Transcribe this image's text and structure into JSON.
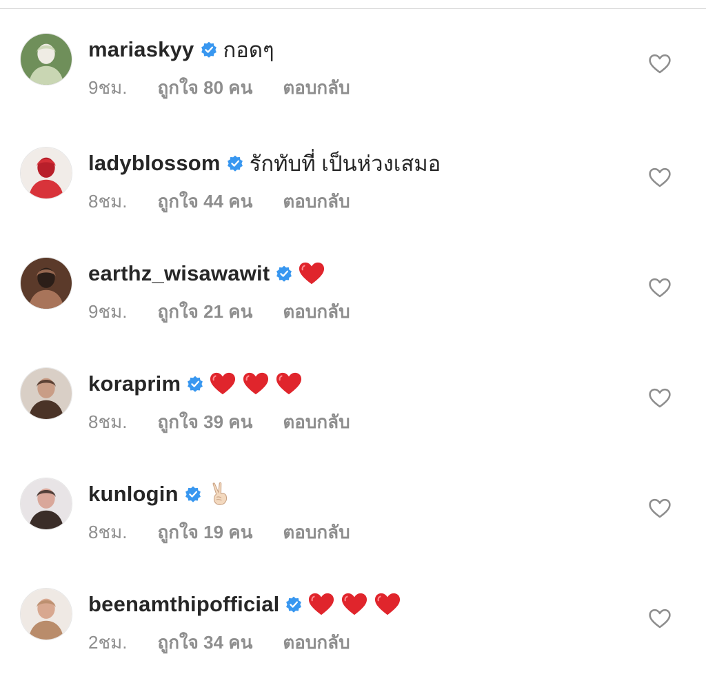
{
  "comments": [
    {
      "username": "mariaskyy",
      "text": "กอดๆ",
      "emojis": [],
      "time": "9ชม.",
      "likes": "ถูกใจ 80 คน",
      "reply": "ตอบกลับ",
      "avatar_icon": "avatar-garden-photo"
    },
    {
      "username": "ladyblossom",
      "text": "รักทับที่ เป็นห่วงเสมอ",
      "emojis": [],
      "time": "8ชม.",
      "likes": "ถูกใจ 44 คน",
      "reply": "ตอบกลับ",
      "avatar_icon": "avatar-red-dress-photo"
    },
    {
      "username": "earthz_wisawawit",
      "text": "",
      "emojis": [
        "red-heart"
      ],
      "time": "9ชม.",
      "likes": "ถูกใจ 21 คน",
      "reply": "ตอบกลับ",
      "avatar_icon": "avatar-portrait-photo"
    },
    {
      "username": "koraprim",
      "text": "",
      "emojis": [
        "red-heart",
        "red-heart",
        "red-heart"
      ],
      "time": "8ชม.",
      "likes": "ถูกใจ 39 คน",
      "reply": "ตอบกลับ",
      "avatar_icon": "avatar-portrait-photo"
    },
    {
      "username": "kunlogin",
      "text": "",
      "emojis": [
        "victory-hand"
      ],
      "time": "8ชม.",
      "likes": "ถูกใจ 19 คน",
      "reply": "ตอบกลับ",
      "avatar_icon": "avatar-portrait-photo"
    },
    {
      "username": "beenamthipofficial",
      "text": "",
      "emojis": [
        "red-heart",
        "red-heart",
        "red-heart"
      ],
      "time": "2ชม.",
      "likes": "ถูกใจ 34 คน",
      "reply": "ตอบกลับ",
      "avatar_icon": "avatar-portrait-photo"
    }
  ],
  "colors": {
    "verified_badge": "#3897f0",
    "meta_text": "#8e8e8e",
    "primary_text": "#262626",
    "heart_emoji": "#e0252c",
    "like_outline": "#8e8e8e"
  }
}
